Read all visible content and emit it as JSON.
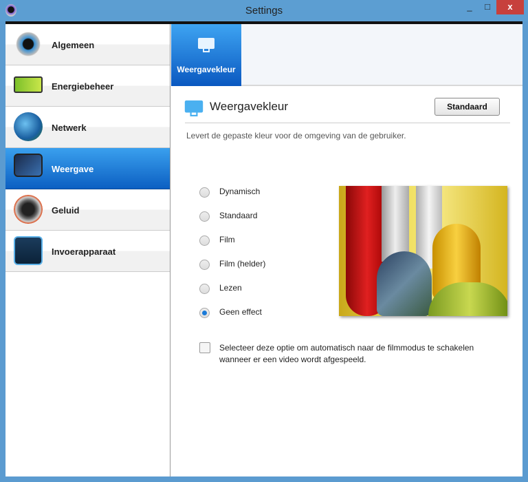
{
  "window": {
    "title": "Settings",
    "minimize": "_",
    "maximize": "□",
    "close": "x"
  },
  "sidebar": {
    "items": [
      {
        "label": "Algemeen",
        "icon": "gear-icon",
        "selected": false
      },
      {
        "label": "Energiebeheer",
        "icon": "battery-icon",
        "selected": false
      },
      {
        "label": "Netwerk",
        "icon": "globe-wifi-icon",
        "selected": false
      },
      {
        "label": "Weergave",
        "icon": "display-icon",
        "selected": true
      },
      {
        "label": "Geluid",
        "icon": "speaker-icon",
        "selected": false
      },
      {
        "label": "Invoerapparaat",
        "icon": "touch-icon",
        "selected": false
      }
    ]
  },
  "tabs": [
    {
      "label": "Weergavekleur",
      "selected": true
    }
  ],
  "section": {
    "title": "Weergavekleur",
    "reset_label": "Standaard",
    "description": "Levert de gepaste kleur voor de omgeving van de gebruiker."
  },
  "modes": [
    {
      "label": "Dynamisch",
      "selected": false
    },
    {
      "label": "Standaard",
      "selected": false
    },
    {
      "label": "Film",
      "selected": false
    },
    {
      "label": "Film (helder)",
      "selected": false
    },
    {
      "label": "Lezen",
      "selected": false
    },
    {
      "label": "Geen effect",
      "selected": true
    }
  ],
  "auto_film": {
    "label": "Selecteer deze optie om automatisch naar de filmmodus te schakelen wanneer er een video wordt afgespeeld.",
    "checked": false
  }
}
